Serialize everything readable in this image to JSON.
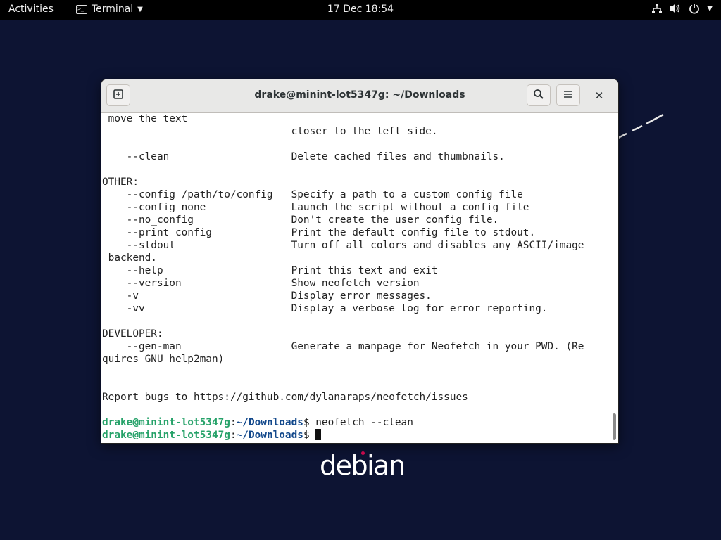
{
  "topbar": {
    "activities": "Activities",
    "app_name": "Terminal",
    "clock": "17 Dec  18:54",
    "icons": [
      "network-icon",
      "volume-icon",
      "power-icon",
      "system-menu-arrow-icon"
    ]
  },
  "window": {
    "title": "drake@minint-lot5347g: ~/Downloads",
    "buttons": [
      "new-tab-icon",
      "search-icon",
      "menu-icon",
      "close-icon"
    ]
  },
  "terminal": {
    "lines": [
      " move the text",
      "                               closer to the left side.",
      "",
      "    --clean                    Delete cached files and thumbnails.",
      "",
      "OTHER:",
      "    --config /path/to/config   Specify a path to a custom config file",
      "    --config none              Launch the script without a config file",
      "    --no_config                Don't create the user config file.",
      "    --print_config             Print the default config file to stdout.",
      "    --stdout                   Turn off all colors and disables any ASCII/image",
      " backend.",
      "    --help                     Print this text and exit",
      "    --version                  Show neofetch version",
      "    -v                         Display error messages.",
      "    -vv                        Display a verbose log for error reporting.",
      "",
      "DEVELOPER:",
      "    --gen-man                  Generate a manpage for Neofetch in your PWD. (Re",
      "quires GNU help2man)",
      "",
      "",
      "Report bugs to https://github.com/dylanaraps/neofetch/issues",
      ""
    ],
    "prompt1": {
      "user": "drake@minint-lot5347g",
      "sep": ":",
      "path": "~/Downloads",
      "symbol": "$ ",
      "command": "neofetch --clean"
    },
    "prompt2": {
      "user": "drake@minint-lot5347g",
      "sep": ":",
      "path": "~/Downloads",
      "symbol": "$ "
    }
  },
  "desktop": {
    "logo_text": "debian",
    "logo_dot_color": "#d70a53",
    "background_color": "#0d1433"
  },
  "colors": {
    "prompt_user": "#26a269",
    "prompt_path": "#12488b"
  }
}
